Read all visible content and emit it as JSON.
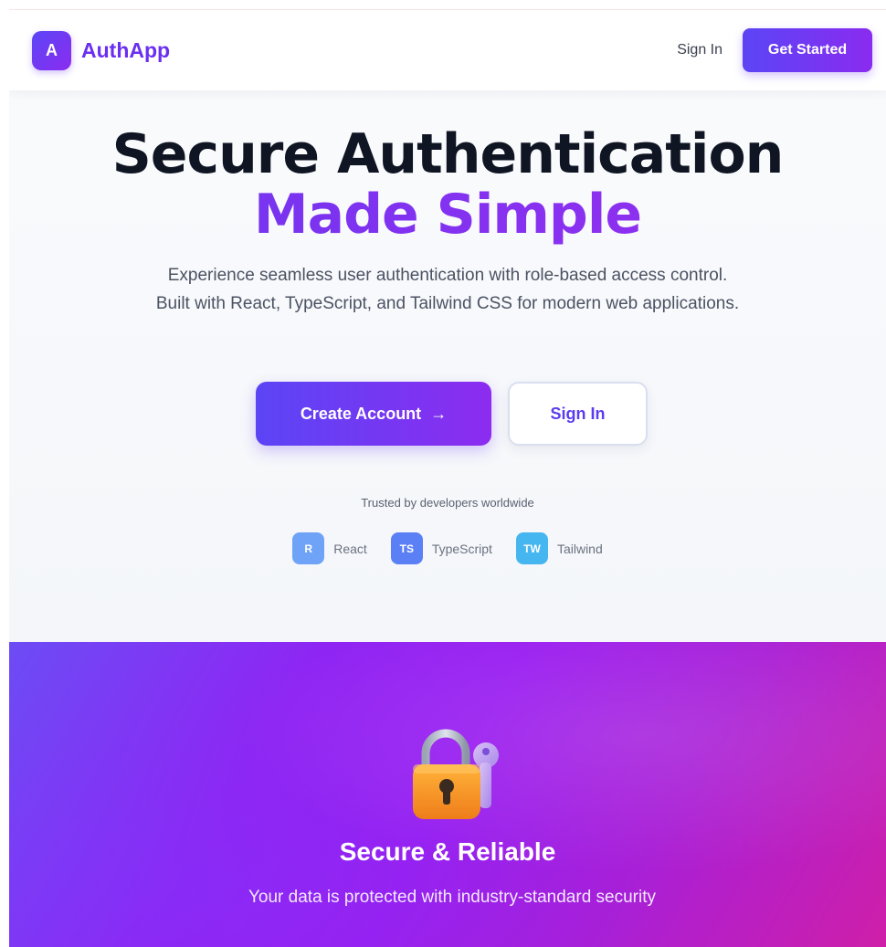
{
  "nav": {
    "brand_letter": "A",
    "brand_name": "AuthApp",
    "signin_label": "Sign In",
    "cta_label": "Get Started"
  },
  "hero": {
    "title_line1": "Secure Authentication",
    "title_line2": "Made Simple",
    "subtitle": "Experience seamless user authentication with role-based access control. Built with React, TypeScript, and Tailwind CSS for modern web applications.",
    "primary_button": "Create Account",
    "primary_arrow": "→",
    "secondary_button": "Sign In",
    "trusted_text": "Trusted by developers worldwide",
    "tech": [
      {
        "badge": "R",
        "name": "React",
        "color": "#6fa3f7"
      },
      {
        "badge": "TS",
        "name": "TypeScript",
        "color": "#5b7ff5"
      },
      {
        "badge": "TW",
        "name": "Tailwind",
        "color": "#45b6f0"
      }
    ]
  },
  "feature": {
    "icon": "lock-key-icon",
    "title": "Secure & Reliable",
    "description": "Your data is protected with industry-standard security"
  },
  "colors": {
    "brand": "#6a2ff0",
    "gradient_start": "#5b45f5",
    "gradient_end": "#8c2cf0",
    "heading": "#0f1523"
  }
}
